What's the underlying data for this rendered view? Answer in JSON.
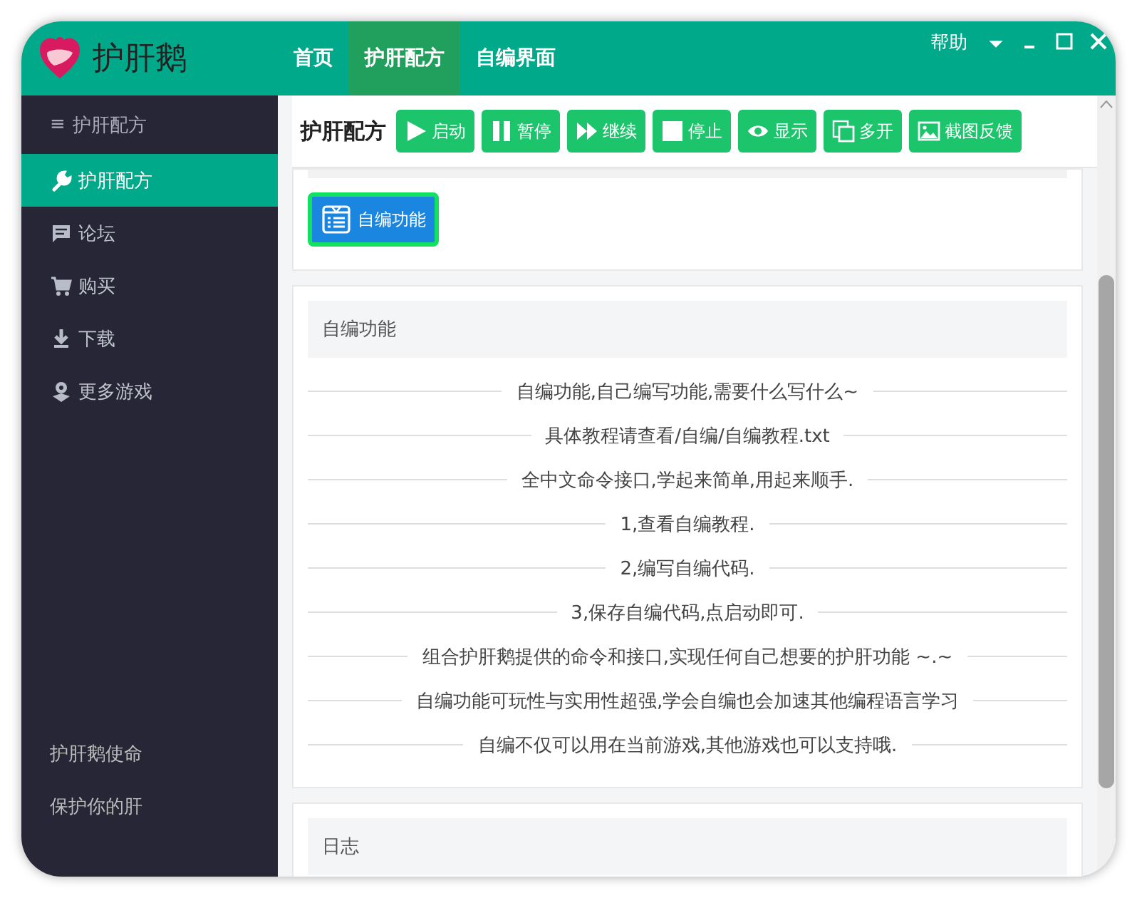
{
  "app": {
    "name": "护肝鹅"
  },
  "nav": [
    {
      "label": "首页",
      "selected": false
    },
    {
      "label": "护肝配方",
      "selected": true
    },
    {
      "label": "自编界面",
      "selected": false
    }
  ],
  "help": {
    "label": "帮助"
  },
  "sidebar": {
    "menu_glyph": "≡",
    "title": "护肝配方",
    "items": [
      {
        "label": "护肝配方",
        "selected": true
      },
      {
        "label": "论坛",
        "selected": false
      },
      {
        "label": "购买",
        "selected": false
      },
      {
        "label": "下载",
        "selected": false
      },
      {
        "label": "更多游戏",
        "selected": false
      }
    ],
    "footer": [
      "护肝鹅使命",
      "保护你的肝"
    ]
  },
  "toolbar": {
    "title": "护肝配方",
    "buttons": [
      "启动",
      "暂停",
      "继续",
      "停止",
      "显示",
      "多开",
      "截图反馈"
    ]
  },
  "feature_button": {
    "label": "自编功能",
    "selected": true
  },
  "panel": {
    "title": "自编功能",
    "lines": [
      "自编功能,自己编写功能,需要什么写什么~",
      "具体教程请查看/自编/自编教程.txt",
      "全中文命令接口,学起来简单,用起来顺手.",
      "1,查看自编教程.",
      "2,编写自编代码.",
      "3,保存自编代码,点启动即可.",
      "组合护肝鹅提供的命令和接口,实现任何自己想要的护肝功能 ~.~",
      "自编功能可玩性与实用性超强,学会自编也会加速其他编程语言学习",
      "自编不仅可以用在当前游戏,其他游戏也可以支持哦."
    ]
  },
  "log": {
    "title": "日志"
  }
}
